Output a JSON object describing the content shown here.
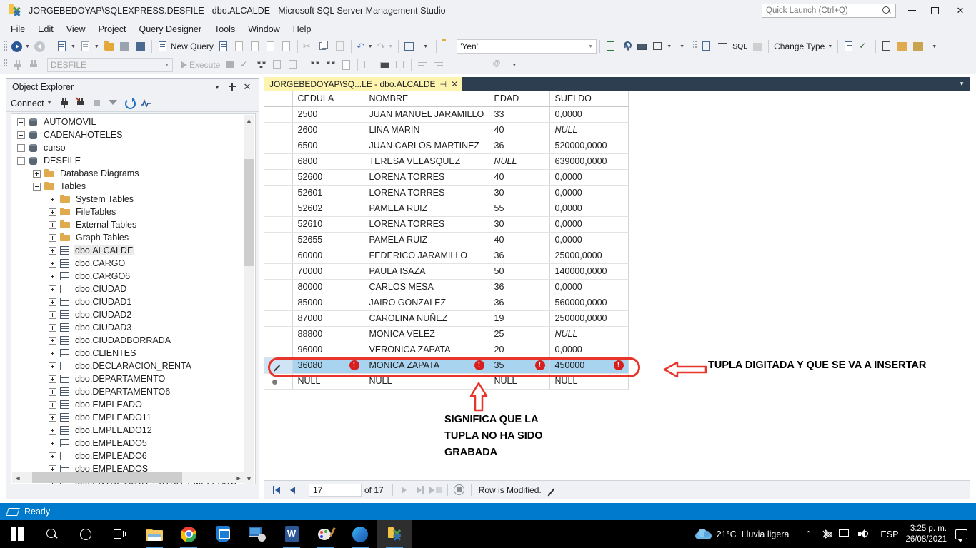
{
  "window": {
    "title": "JORGEBEDOYAP\\SQLEXPRESS.DESFILE - dbo.ALCALDE - Microsoft SQL Server Management Studio",
    "quick_launch_placeholder": "Quick Launch (Ctrl+Q)",
    "minimize": "–",
    "maximize": "□",
    "close": "✕"
  },
  "menu": {
    "items": [
      {
        "label": "File"
      },
      {
        "label": "Edit"
      },
      {
        "label": "View"
      },
      {
        "label": "Project"
      },
      {
        "label": "Query Designer"
      },
      {
        "label": "Tools"
      },
      {
        "label": "Window"
      },
      {
        "label": "Help"
      }
    ]
  },
  "toolbar": {
    "new_query_label": "New Query",
    "filter_value": "'Yen'",
    "change_type_label": "Change Type",
    "database_value": "DESFILE",
    "execute_label": "Execute"
  },
  "object_explorer": {
    "title": "Object Explorer",
    "connect_label": "Connect",
    "tree": [
      {
        "label": "AUTOMOVIL",
        "icon": "database-icon",
        "indent": 1,
        "state": "plus"
      },
      {
        "label": "CADENAHOTELES",
        "icon": "database-icon",
        "indent": 1,
        "state": "plus"
      },
      {
        "label": "curso",
        "icon": "database-icon",
        "indent": 1,
        "state": "plus"
      },
      {
        "label": "DESFILE",
        "icon": "database-icon",
        "indent": 1,
        "state": "minus"
      },
      {
        "label": "Database Diagrams",
        "icon": "folder-icon",
        "indent": 2,
        "state": "plus"
      },
      {
        "label": "Tables",
        "icon": "folder-icon",
        "indent": 2,
        "state": "minus"
      },
      {
        "label": "System Tables",
        "icon": "folder-icon",
        "indent": 3,
        "state": "plus"
      },
      {
        "label": "FileTables",
        "icon": "folder-icon",
        "indent": 3,
        "state": "plus"
      },
      {
        "label": "External Tables",
        "icon": "folder-icon",
        "indent": 3,
        "state": "plus"
      },
      {
        "label": "Graph Tables",
        "icon": "folder-icon",
        "indent": 3,
        "state": "plus"
      },
      {
        "label": "dbo.ALCALDE",
        "icon": "table-icon",
        "indent": 3,
        "state": "plus",
        "selected": true
      },
      {
        "label": "dbo.CARGO",
        "icon": "table-icon",
        "indent": 3,
        "state": "plus"
      },
      {
        "label": "dbo.CARGO6",
        "icon": "table-icon",
        "indent": 3,
        "state": "plus"
      },
      {
        "label": "dbo.CIUDAD",
        "icon": "table-icon",
        "indent": 3,
        "state": "plus"
      },
      {
        "label": "dbo.CIUDAD1",
        "icon": "table-icon",
        "indent": 3,
        "state": "plus"
      },
      {
        "label": "dbo.CIUDAD2",
        "icon": "table-icon",
        "indent": 3,
        "state": "plus"
      },
      {
        "label": "dbo.CIUDAD3",
        "icon": "table-icon",
        "indent": 3,
        "state": "plus"
      },
      {
        "label": "dbo.CIUDADBORRADA",
        "icon": "table-icon",
        "indent": 3,
        "state": "plus"
      },
      {
        "label": "dbo.CLIENTES",
        "icon": "table-icon",
        "indent": 3,
        "state": "plus"
      },
      {
        "label": "dbo.DECLARACION_RENTA",
        "icon": "table-icon",
        "indent": 3,
        "state": "plus"
      },
      {
        "label": "dbo.DEPARTAMENTO",
        "icon": "table-icon",
        "indent": 3,
        "state": "plus"
      },
      {
        "label": "dbo.DEPARTAMENTO6",
        "icon": "table-icon",
        "indent": 3,
        "state": "plus"
      },
      {
        "label": "dbo.EMPLEADO",
        "icon": "table-icon",
        "indent": 3,
        "state": "plus"
      },
      {
        "label": "dbo.EMPLEADO11",
        "icon": "table-icon",
        "indent": 3,
        "state": "plus"
      },
      {
        "label": "dbo.EMPLEADO12",
        "icon": "table-icon",
        "indent": 3,
        "state": "plus"
      },
      {
        "label": "dbo.EMPLEADO5",
        "icon": "table-icon",
        "indent": 3,
        "state": "plus"
      },
      {
        "label": "dbo.EMPLEADO6",
        "icon": "table-icon",
        "indent": 3,
        "state": "plus"
      },
      {
        "label": "dbo.EMPLEADOS",
        "icon": "table-icon",
        "indent": 3,
        "state": "plus"
      },
      {
        "label": "dbo.ENTREVISTA_EXTRA_EMPLEADO",
        "icon": "table-icon",
        "indent": 3,
        "state": "plus"
      }
    ]
  },
  "document_tab": {
    "label": "JORGEBEDOYAP\\SQ...LE - dbo.ALCALDE"
  },
  "grid": {
    "columns": [
      "CEDULA",
      "NOMBRE",
      "EDAD",
      "SUELDO"
    ],
    "rows": [
      {
        "cedula": "2500",
        "nombre": "JUAN MANUEL JARAMILLO",
        "edad": "33",
        "sueldo": "0,0000"
      },
      {
        "cedula": "2600",
        "nombre": "LINA MARIN",
        "edad": "40",
        "sueldo": "NULL",
        "sueldo_null": true
      },
      {
        "cedula": "6500",
        "nombre": "JUAN CARLOS MARTINEZ",
        "edad": "36",
        "sueldo": "520000,0000"
      },
      {
        "cedula": "6800",
        "nombre": "TERESA VELASQUEZ",
        "edad": "NULL",
        "edad_null": true,
        "sueldo": "639000,0000"
      },
      {
        "cedula": "52600",
        "nombre": "LORENA TORRES",
        "edad": "40",
        "sueldo": "0,0000"
      },
      {
        "cedula": "52601",
        "nombre": "LORENA TORRES",
        "edad": "30",
        "sueldo": "0,0000"
      },
      {
        "cedula": "52602",
        "nombre": "PAMELA RUIZ",
        "edad": "55",
        "sueldo": "0,0000"
      },
      {
        "cedula": "52610",
        "nombre": "LORENA TORRES",
        "edad": "30",
        "sueldo": "0,0000"
      },
      {
        "cedula": "52655",
        "nombre": "PAMELA RUIZ",
        "edad": "40",
        "sueldo": "0,0000"
      },
      {
        "cedula": "60000",
        "nombre": "FEDERICO JARAMILLO",
        "edad": "36",
        "sueldo": "25000,0000"
      },
      {
        "cedula": "70000",
        "nombre": "PAULA ISAZA",
        "edad": "50",
        "sueldo": "140000,0000"
      },
      {
        "cedula": "80000",
        "nombre": "CARLOS MESA",
        "edad": "36",
        "sueldo": "0,0000"
      },
      {
        "cedula": "85000",
        "nombre": "JAIRO GONZALEZ",
        "edad": "36",
        "sueldo": "560000,0000"
      },
      {
        "cedula": "87000",
        "nombre": "CAROLINA NUÑEZ",
        "edad": "19",
        "sueldo": "250000,0000"
      },
      {
        "cedula": "88800",
        "nombre": "MONICA VELEZ",
        "edad": "25",
        "sueldo": "NULL",
        "sueldo_null": true
      },
      {
        "cedula": "96000",
        "nombre": "VERONICA ZAPATA",
        "edad": "20",
        "sueldo": "0,0000"
      },
      {
        "cedula": "36080",
        "nombre": "MONICA ZAPATA",
        "edad": "35",
        "sueldo": "450000",
        "selected": true,
        "error": true
      },
      {
        "cedula": "NULL",
        "nombre": "NULL",
        "edad": "NULL",
        "sueldo": "NULL",
        "new_row": true
      }
    ],
    "error_glyph": "!"
  },
  "nav": {
    "current_row": "17",
    "of_label": "of 17",
    "status": "Row is Modified."
  },
  "annotations": {
    "right_text": "TUPLA DIGITADA Y QUE SE VA A INSERTAR",
    "bottom_line1": "SIGNIFICA QUE LA",
    "bottom_line2": "TUPLA NO HA SIDO",
    "bottom_line3": "GRABADA",
    "color": "#e8352b"
  },
  "statusbar": {
    "text": "Ready"
  },
  "taskbar": {
    "items": [
      {
        "name": "start-button",
        "label": "Start"
      },
      {
        "name": "search-icon",
        "label": "Search"
      },
      {
        "name": "cortana-icon",
        "label": "Cortana"
      },
      {
        "name": "task-view-icon",
        "label": "Task View"
      },
      {
        "name": "file-explorer-icon",
        "label": "File Explorer"
      },
      {
        "name": "chrome-icon",
        "label": "Google Chrome"
      },
      {
        "name": "defender-icon",
        "label": "Windows Security"
      },
      {
        "name": "remote-desktop-icon",
        "label": "Remote Desktop"
      },
      {
        "name": "word-icon",
        "label": "Microsoft Word"
      },
      {
        "name": "paint-icon",
        "label": "Paint"
      },
      {
        "name": "edge-icon",
        "label": "Microsoft Edge"
      },
      {
        "name": "ssms-icon",
        "label": "SQL Server Management Studio"
      }
    ],
    "tray": {
      "temperature": "21°C",
      "weather": "Lluvia ligera",
      "language": "ESP",
      "time": "3:25 p. m.",
      "date": "26/08/2021"
    }
  }
}
